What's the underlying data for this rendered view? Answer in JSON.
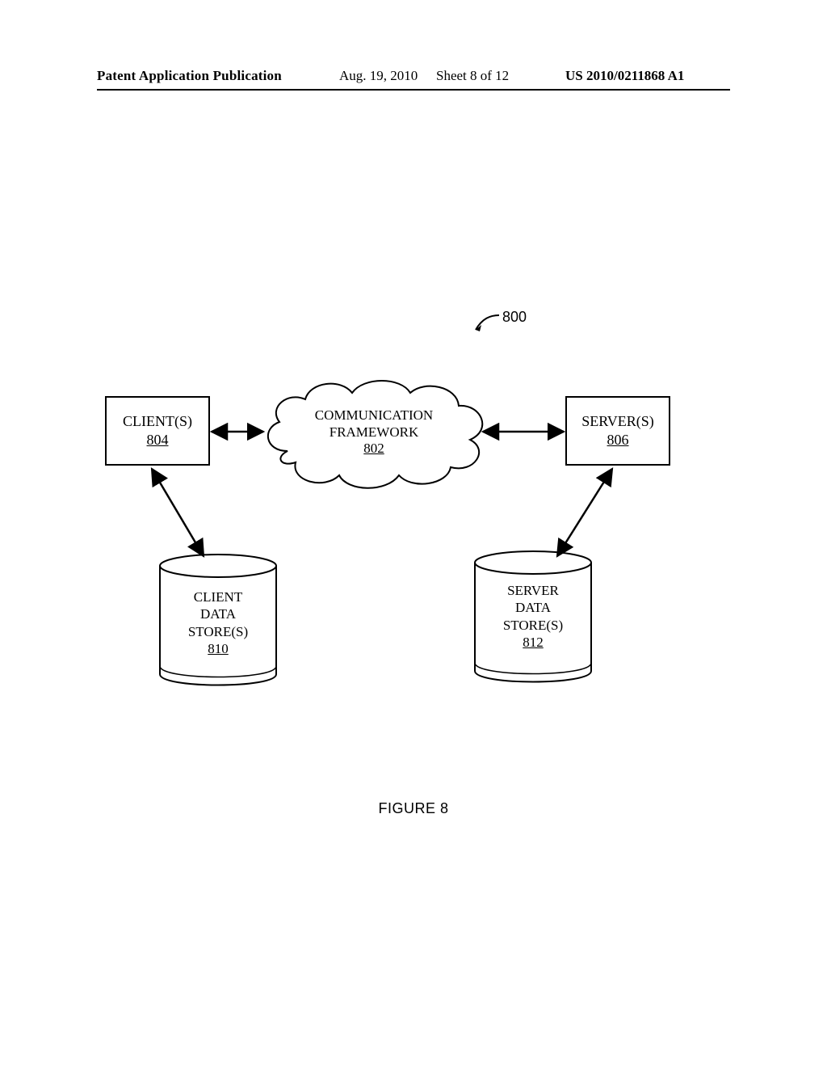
{
  "header": {
    "publication": "Patent Application Publication",
    "date": "Aug. 19, 2010",
    "sheet": "Sheet 8 of 12",
    "docnum": "US 2010/0211868 A1"
  },
  "figure": {
    "label": "FIGURE 8",
    "refnum": "800"
  },
  "nodes": {
    "client": {
      "title": "CLIENT(S)",
      "num": "804"
    },
    "server": {
      "title": "SERVER(S)",
      "num": "806"
    },
    "cloud": {
      "line1": "COMMUNICATION",
      "line2": "FRAMEWORK",
      "num": "802"
    },
    "client_store": {
      "line1": "CLIENT",
      "line2": "DATA",
      "line3": "STORE(S)",
      "num": "810"
    },
    "server_store": {
      "line1": "SERVER",
      "line2": "DATA",
      "line3": "STORE(S)",
      "num": "812"
    }
  }
}
